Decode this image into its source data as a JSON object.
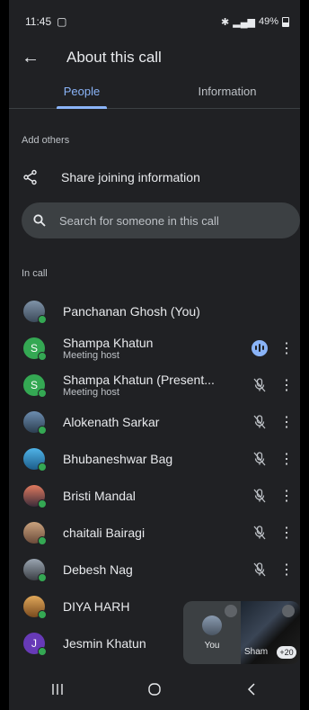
{
  "status": {
    "time": "11:45",
    "indicators": "LTE1 LTE2",
    "battery": "49%"
  },
  "appbar": {
    "title": "About this call"
  },
  "tabs": [
    {
      "label": "People"
    },
    {
      "label": "Information"
    }
  ],
  "add_others": {
    "label": "Add others",
    "share_label": "Share joining information",
    "search_placeholder": "Search for someone in this call"
  },
  "in_call": {
    "label": "In call"
  },
  "participants": [
    {
      "name": "Panchanan Ghosh (You)",
      "role": "",
      "initial": "",
      "mic": "none"
    },
    {
      "name": "Shampa Khatun",
      "role": "Meeting host",
      "initial": "S",
      "mic": "speaking"
    },
    {
      "name": "Shampa Khatun (Present...",
      "role": "Meeting host",
      "initial": "S",
      "mic": "muted"
    },
    {
      "name": "Alokenath Sarkar",
      "role": "",
      "initial": "",
      "mic": "muted"
    },
    {
      "name": "Bhubaneshwar Bag",
      "role": "",
      "initial": "",
      "mic": "muted"
    },
    {
      "name": "Bristi Mandal",
      "role": "",
      "initial": "",
      "mic": "muted"
    },
    {
      "name": "chaitali Bairagi",
      "role": "",
      "initial": "",
      "mic": "muted"
    },
    {
      "name": "Debesh Nag",
      "role": "",
      "initial": "",
      "mic": "muted"
    },
    {
      "name": "DIYA HARH",
      "role": "",
      "initial": "",
      "mic": "muted"
    },
    {
      "name": "Jesmin Khatun",
      "role": "",
      "initial": "J",
      "mic": "muted"
    }
  ],
  "pip": {
    "self_label": "You",
    "presenter_label": "Sham",
    "more_count": "+20"
  },
  "colors": {
    "accent": "#8ab4f8",
    "surface": "#202124",
    "online": "#34a853"
  }
}
